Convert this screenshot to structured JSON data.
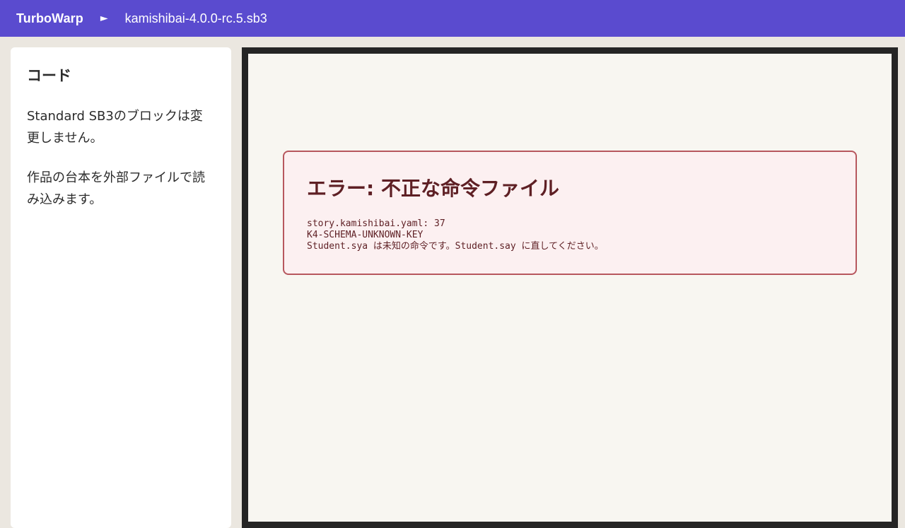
{
  "topbar": {
    "brand": "TurboWarp",
    "play_glyph": "►",
    "play_icon": "play-icon",
    "filename": "kamishibai-4.0.0-rc.5.sb3"
  },
  "sidebar": {
    "title": "コード",
    "paragraphs": [
      "Standard SB3のブロックは変更しません。",
      "作品の台本を外部ファイルで読み込みます。"
    ]
  },
  "error": {
    "title": "エラー: 不正な命令ファイル",
    "lines": [
      "story.kamishibai.yaml: 37",
      "K4-SCHEMA-UNKNOWN-KEY",
      "Student.sya は未知の命令です。Student.say に直してください。"
    ]
  },
  "colors": {
    "topbar": "#5a4bcf",
    "background": "#ebe7e0",
    "stage_border": "#252525",
    "stage_background": "#f8f6f1",
    "error_background": "#fcf0f1",
    "error_border": "#b7575e",
    "error_text": "#5e1f24"
  }
}
